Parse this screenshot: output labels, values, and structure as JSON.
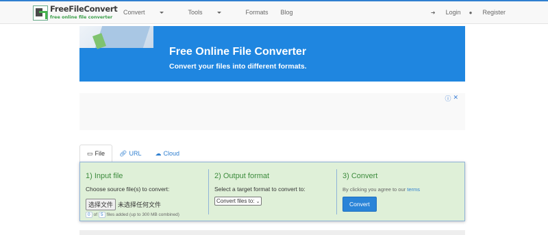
{
  "header": {
    "logo_title": "FreeFileConvert",
    "logo_subtitle": "free online file converter",
    "nav": [
      "Convert",
      "Tools",
      "Formats",
      "Blog"
    ],
    "login": "Login",
    "register": "Register"
  },
  "banner": {
    "title": "Free Online File Converter",
    "subtitle": "Convert your files into different formats."
  },
  "ad": {
    "icons": [
      "info-icon",
      "close-icon"
    ]
  },
  "tabs": [
    {
      "label": "File",
      "icon": "monitor-icon",
      "active": true
    },
    {
      "label": "URL",
      "icon": "link-icon",
      "active": false
    },
    {
      "label": "Cloud",
      "icon": "cloud-icon",
      "active": false
    }
  ],
  "steps": {
    "input": {
      "title": "1) Input file",
      "desc": "Choose source file(s) to convert:",
      "button": "选择文件",
      "no_file": "未选择任何文件",
      "count_added": "0",
      "of": "of",
      "count_max": "5",
      "limit_text": "files added (up to 300 MB combined)"
    },
    "output": {
      "title": "2) Output format",
      "desc": "Select a target format to convert to:",
      "select_value": "Convert files to:"
    },
    "convert": {
      "title": "3) Convert",
      "desc_prefix": "By clicking you agree to our",
      "terms": "terms",
      "button": "Convert"
    }
  },
  "colors": {
    "accent": "#2f7fd0",
    "banner": "#1f86e0",
    "panel_bg": "#dff0d8",
    "step_title": "#3c8b3c"
  }
}
